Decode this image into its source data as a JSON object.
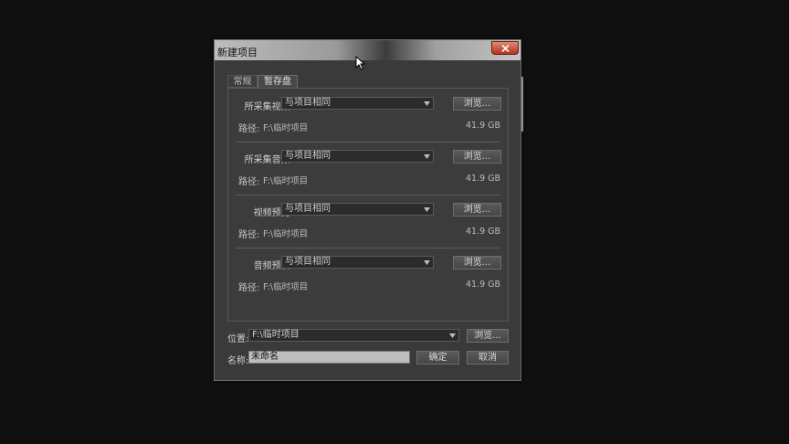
{
  "dialog": {
    "title": "新建项目",
    "tabs": [
      {
        "label": "常规"
      },
      {
        "label": "暂存盘"
      }
    ],
    "sections": [
      {
        "label": "所采集视频:",
        "value": "与项目相同",
        "browse": "浏览...",
        "path_label": "路径:",
        "path": "F:\\临时项目",
        "size": "41.9 GB"
      },
      {
        "label": "所采集音频:",
        "value": "与项目相同",
        "browse": "浏览...",
        "path_label": "路径:",
        "path": "F:\\临时项目",
        "size": "41.9 GB"
      },
      {
        "label": "视频预览:",
        "value": "与项目相同",
        "browse": "浏览...",
        "path_label": "路径:",
        "path": "F:\\临时项目",
        "size": "41.9 GB"
      },
      {
        "label": "音频预演:",
        "value": "与项目相同",
        "browse": "浏览...",
        "path_label": "路径:",
        "path": "F:\\临时项目",
        "size": "41.9 GB"
      }
    ],
    "location_label": "位置:",
    "location_value": "F:\\临时项目",
    "location_browse": "浏览...",
    "name_label": "名称:",
    "name_value": "未命名",
    "ok": "确定",
    "cancel": "取消"
  },
  "colors": {
    "background": "#0e0f0e",
    "dialog": "#3a3a3a",
    "close_button": "#b1331c"
  }
}
